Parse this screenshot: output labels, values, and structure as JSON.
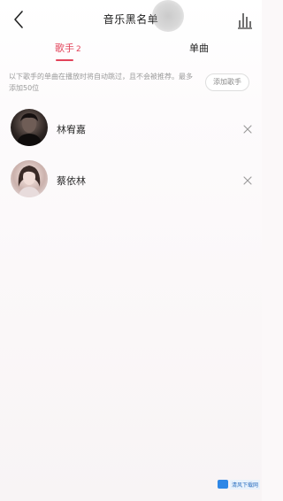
{
  "header": {
    "title": "音乐黑名单",
    "back_icon": "chevron-left-icon",
    "chart_icon": "bar-chart-icon"
  },
  "tabs": [
    {
      "label": "歌手",
      "count": "2",
      "active": true
    },
    {
      "label": "单曲",
      "active": false
    }
  ],
  "notice": {
    "text": "以下歌手的单曲在播放时将自动跳过，且不会被推荐。最多添加50位",
    "add_button": "添加歌手"
  },
  "blacklist": [
    {
      "name": "林宥嘉",
      "avatar": "avatar-lin"
    },
    {
      "name": "蔡依林",
      "avatar": "avatar-cai"
    }
  ],
  "watermark": {
    "text": "清风下载网"
  },
  "colors": {
    "accent": "#e2435a",
    "text": "#1b1b1b",
    "muted": "#9a9a9a",
    "background": "#fbf8f9"
  }
}
